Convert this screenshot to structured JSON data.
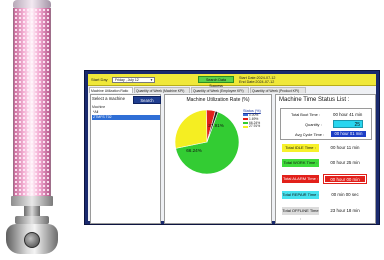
{
  "toolbar": {
    "start_day_label": "Start Day",
    "start_day_value": "Friday ,    July    12",
    "search_button": "Search Data Success",
    "start_date": "Start Date:2024-07-12",
    "end_date": "End Date:2024-07-12"
  },
  "tabs": [
    "Machine Utilization Ratio",
    "Quantity of Week (Machine KPI)",
    "Quantity of Week (Employee KPI)",
    "Quantity of Week (Product KPI)"
  ],
  "machine_panel": {
    "title": "Select a machine",
    "search_button": "Search",
    "column_header": "Machine",
    "items": [
      "*All",
      "ZTMFS T02"
    ],
    "selected_index": 1
  },
  "chart_panel": {
    "title": "Machine Utilization Rate (%)",
    "legend_title": "Status (%)",
    "labels": {
      "green": "66.24%",
      "yellow": "27.91%"
    }
  },
  "chart_data": {
    "type": "pie",
    "title": "Machine Utilization Rate (%)",
    "slices": [
      {
        "value": 66.24,
        "color": "#33cc33"
      },
      {
        "value": 27.91,
        "color": "#f5ee22"
      },
      {
        "value": 4.5,
        "color": "#e0201c"
      },
      {
        "value": 1.35,
        "color": "#222222"
      }
    ],
    "legend": [
      "0.00%",
      "1.69%",
      "66.24%",
      "27.91%"
    ],
    "legend_colors": [
      "#4070d8",
      "#e0201c",
      "#33cc33",
      "#f5ee22"
    ]
  },
  "status_panel": {
    "title": "Machine Time Status List :",
    "total_boot_label": "Total Boot Time :",
    "total_boot_value": "00 hour 41 min",
    "quantity_label": "Quantity :",
    "quantity_value": "25",
    "avg_cycle_label": "Avg Cycle Time :",
    "avg_cycle_value": "00 hour 01 min",
    "rows": [
      {
        "label": "Total IDLE Time :",
        "value": "00 hour 11 min"
      },
      {
        "label": "Total WORK Time :",
        "value": "00 hour 25 min"
      },
      {
        "label": "Total ALARM Time :",
        "value": "00 hour 00 min"
      },
      {
        "label": "Total REPAIR Time :",
        "value": "00 min  00 sec"
      },
      {
        "label": "Total OFFLINE Time :",
        "value": "23 hour 18 min"
      }
    ]
  },
  "colors": {
    "toolbar_bg": "#f0e83a",
    "window_frame": "#1a2a6e",
    "idle": "#f7f12b",
    "work": "#3fdc3b",
    "alarm": "#e2201a",
    "repair": "#47e2ef",
    "offline": "#dcdcdc"
  }
}
